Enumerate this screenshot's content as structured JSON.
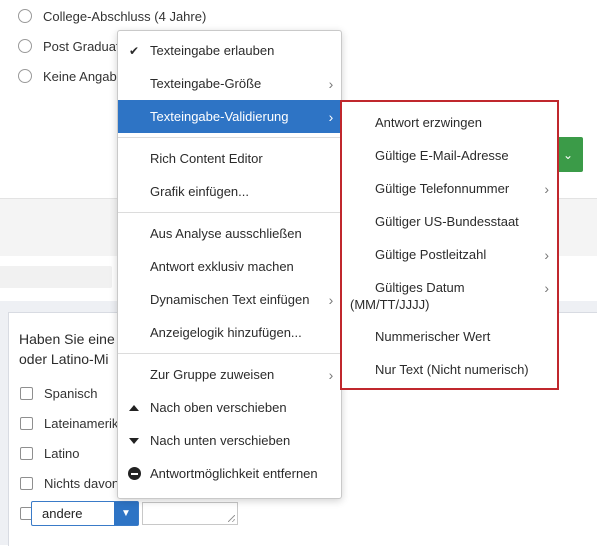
{
  "background": {
    "radio_options": [
      "College-Abschluss (4 Jahre)",
      "Post Graduat",
      "Keine Angabe"
    ],
    "question_title": "Haben Sie eine oder Latino-Mi",
    "checkbox_options": [
      "Spanisch",
      "Lateinamerik",
      "Latino",
      "Nichts davon"
    ],
    "other_select_value": "andere"
  },
  "menu": {
    "items": [
      {
        "label": "Texteingabe erlauben",
        "icon": "checkmark-icon",
        "submenu": false
      },
      {
        "label": "Texteingabe-Größe",
        "icon": "",
        "submenu": true
      },
      {
        "label": "Texteingabe-Validierung",
        "icon": "",
        "submenu": true,
        "active": true
      },
      {
        "label": "Rich Content Editor",
        "icon": "",
        "submenu": false
      },
      {
        "label": "Grafik einfügen...",
        "icon": "",
        "submenu": false
      },
      {
        "label": "Aus Analyse ausschließen",
        "icon": "",
        "submenu": false
      },
      {
        "label": "Antwort exklusiv machen",
        "icon": "",
        "submenu": false
      },
      {
        "label": "Dynamischen Text einfügen",
        "icon": "",
        "submenu": true
      },
      {
        "label": "Anzeigelogik hinzufügen...",
        "icon": "",
        "submenu": false
      },
      {
        "label": "Zur Gruppe zuweisen",
        "icon": "",
        "submenu": true
      },
      {
        "label": "Nach oben verschieben",
        "icon": "arrow-up-icon",
        "submenu": false
      },
      {
        "label": "Nach unten verschieben",
        "icon": "arrow-down-icon",
        "submenu": false
      },
      {
        "label": "Antwortmöglichkeit entfernen",
        "icon": "remove-circle-icon",
        "submenu": false
      }
    ]
  },
  "submenu": {
    "items": [
      {
        "label": "Antwort erzwingen",
        "submenu": false
      },
      {
        "label": "Gültige E-Mail-Adresse",
        "submenu": false
      },
      {
        "label": "Gültige Telefonnummer",
        "submenu": true
      },
      {
        "label": "Gültiger US-Bundesstaat",
        "submenu": false
      },
      {
        "label": "Gültige Postleitzahl",
        "submenu": true
      },
      {
        "label": "Gültiges Datum",
        "label2": "(MM/TT/JJJJ)",
        "submenu": true
      },
      {
        "label": "Nummerischer Wert",
        "submenu": false
      },
      {
        "label": "Nur Text (Nicht numerisch)",
        "submenu": false
      }
    ]
  },
  "colors": {
    "accent": "#2e74c5",
    "highlight_border": "#c0272d",
    "green_button": "#3b9b48"
  }
}
